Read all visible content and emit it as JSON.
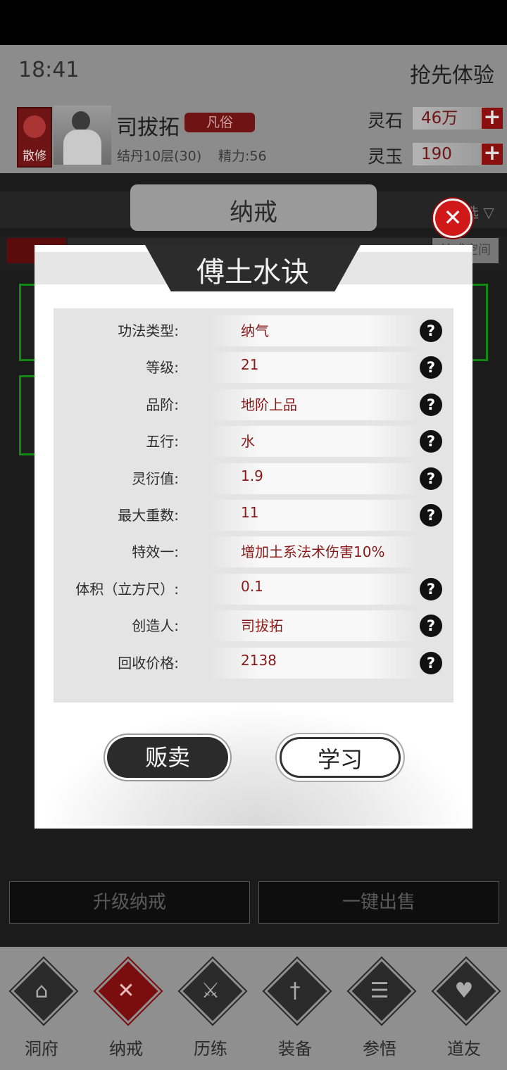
{
  "status_bar": {
    "time": "18:41",
    "early_access": "抢先体验"
  },
  "player": {
    "sect_label": "散修",
    "name": "司拔拓",
    "rank": "凡俗",
    "realm": "结丹10层(30)",
    "energy": "精力:56"
  },
  "currency": {
    "spirit_stone": {
      "label": "灵石",
      "value": "46万"
    },
    "spirit_jade": {
      "label": "灵玉",
      "value": "190"
    },
    "plus_glyph": "+"
  },
  "page": {
    "title": "纳戒",
    "filter_label": "选",
    "tab_space": "纳戒空间",
    "bottom_buttons": {
      "upgrade": "升级纳戒",
      "sell_all": "一键出售"
    }
  },
  "dialog": {
    "title": "傅土水诀",
    "close_glyph": "✕",
    "help_glyph": "?",
    "attributes": [
      {
        "key": "功法类型:",
        "value": "纳气",
        "help": true
      },
      {
        "key": "等级:",
        "value": "21",
        "help": true
      },
      {
        "key": "品阶:",
        "value": "地阶上品",
        "help": true
      },
      {
        "key": "五行:",
        "value": "水",
        "help": true
      },
      {
        "key": "灵衍值:",
        "value": "1.9",
        "help": true
      },
      {
        "key": "最大重数:",
        "value": "11",
        "help": true
      },
      {
        "key": "特效一:",
        "value": "增加土系法术伤害10%",
        "help": false
      },
      {
        "key": "体积（立方尺）:",
        "value": "0.1",
        "help": true
      },
      {
        "key": "创造人:",
        "value": "司拔拓",
        "help": true
      },
      {
        "key": "回收价格:",
        "value": "2138",
        "help": true
      }
    ],
    "sell_label": "贩卖",
    "learn_label": "学习"
  },
  "nav": [
    {
      "label": "洞府",
      "icon": "cave-icon",
      "active": false
    },
    {
      "label": "纳戒",
      "icon": "ring-icon",
      "active": true
    },
    {
      "label": "历练",
      "icon": "crossed-swords-icon",
      "active": false
    },
    {
      "label": "装备",
      "icon": "sword-icon",
      "active": false
    },
    {
      "label": "参悟",
      "icon": "book-icon",
      "active": false
    },
    {
      "label": "道友",
      "icon": "handshake-icon",
      "active": false
    }
  ]
}
